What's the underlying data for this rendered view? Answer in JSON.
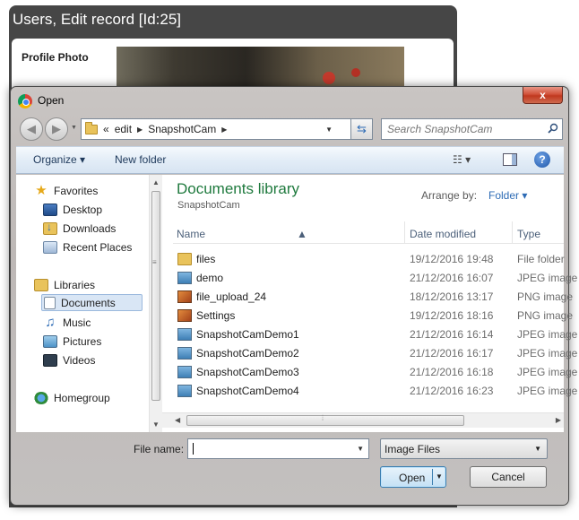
{
  "background_page": {
    "title": "Users, Edit record [Id:25]",
    "field_label": "Profile Photo"
  },
  "dialog": {
    "title": "Open",
    "close_label": "x"
  },
  "address_bar": {
    "overflow": "«",
    "crumbs": [
      "edit",
      "SnapshotCam"
    ]
  },
  "search": {
    "placeholder": "Search SnapshotCam"
  },
  "toolbar": {
    "organize_label": "Organize ▾",
    "new_folder_label": "New folder",
    "view_label": "☷ ▾",
    "help_label": "?"
  },
  "nav": {
    "favorites_label": "Favorites",
    "favorites": [
      "Desktop",
      "Downloads",
      "Recent Places"
    ],
    "libraries_label": "Libraries",
    "libraries": [
      "Documents",
      "Music",
      "Pictures",
      "Videos"
    ],
    "homegroup_label": "Homegroup",
    "selected": "Documents"
  },
  "library": {
    "title": "Documents library",
    "subtitle": "SnapshotCam",
    "arrange_label": "Arrange by:",
    "arrange_value": "Folder ▾",
    "columns": {
      "name": "Name",
      "date": "Date modified",
      "type": "Type"
    },
    "files": [
      {
        "name": "files",
        "date": "19/12/2016 19:48",
        "type": "File folder",
        "icon": "folder-icon"
      },
      {
        "name": "demo",
        "date": "21/12/2016 16:07",
        "type": "JPEG image",
        "icon": "jpeg-icon"
      },
      {
        "name": "file_upload_24",
        "date": "18/12/2016 13:17",
        "type": "PNG image",
        "icon": "png-icon"
      },
      {
        "name": "Settings",
        "date": "19/12/2016 18:16",
        "type": "PNG image",
        "icon": "png-icon"
      },
      {
        "name": "SnapshotCamDemo1",
        "date": "21/12/2016 16:14",
        "type": "JPEG image",
        "icon": "jpeg-icon"
      },
      {
        "name": "SnapshotCamDemo2",
        "date": "21/12/2016 16:17",
        "type": "JPEG image",
        "icon": "jpeg-icon"
      },
      {
        "name": "SnapshotCamDemo3",
        "date": "21/12/2016 16:18",
        "type": "JPEG image",
        "icon": "jpeg-icon"
      },
      {
        "name": "SnapshotCamDemo4",
        "date": "21/12/2016 16:23",
        "type": "JPEG image",
        "icon": "jpeg-icon"
      }
    ]
  },
  "bottom": {
    "file_name_label": "File name:",
    "file_name_value": "",
    "file_type": "Image Files",
    "open_label": "Open",
    "cancel_label": "Cancel"
  },
  "colors": {
    "library_title": "#1f7a3e",
    "link": "#2d6bb5",
    "close_button": "#c0381f"
  }
}
